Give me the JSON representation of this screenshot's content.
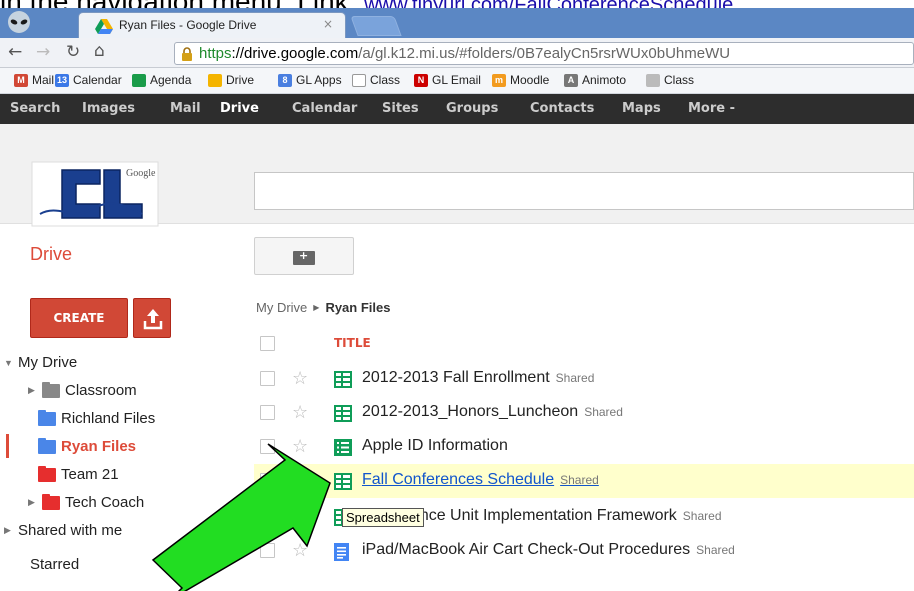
{
  "caption": {
    "text": "in the navigation menu.  Link: ",
    "link": "www.tinyurl.com/FallConferenceSchedule"
  },
  "browser": {
    "tab_title": "Ryan Files - Google Drive",
    "tab_close": "×",
    "url_scheme": "https",
    "url_host": "://drive.google.com",
    "url_path": "/a/gl.k12.mi.us/#folders/0B7ealyCn5rsrWUx0bUhmeWU"
  },
  "bookmarks": [
    {
      "label": "Mail",
      "icon": "gmail-icon",
      "color": "#d14836",
      "glyph": "M"
    },
    {
      "label": "Calendar",
      "icon": "calendar-icon",
      "color": "#3b78e7",
      "glyph": "13"
    },
    {
      "label": "Agenda",
      "icon": "agenda-icon",
      "color": "#1a9c4a",
      "glyph": ""
    },
    {
      "label": "Drive",
      "icon": "drive-icon",
      "color": "#f4b400",
      "glyph": ""
    },
    {
      "label": "GL Apps",
      "icon": "gl-apps-icon",
      "color": "#4a7fe0",
      "glyph": "8"
    },
    {
      "label": "Class",
      "icon": "page-icon",
      "color": "#ffffff",
      "glyph": ""
    },
    {
      "label": "GL Email",
      "icon": "gl-email-icon",
      "color": "#cc0000",
      "glyph": "N"
    },
    {
      "label": "Moodle",
      "icon": "moodle-icon",
      "color": "#f29b1f",
      "glyph": "m"
    },
    {
      "label": "Animoto",
      "icon": "animoto-icon",
      "color": "#777777",
      "glyph": "A"
    },
    {
      "label": "Class",
      "icon": "class-icon",
      "color": "#bbbbbb",
      "glyph": ""
    }
  ],
  "gbar": [
    "Search",
    "Images",
    "Mail",
    "Drive",
    "Calendar",
    "Sites",
    "Groups",
    "Contacts",
    "Maps",
    "More -"
  ],
  "org_logo_text": "Google",
  "app_title": "Drive",
  "create_label": "CREATE",
  "tree": [
    {
      "label": "My Drive",
      "caret": "▼",
      "folder": null
    },
    {
      "label": "Classroom",
      "caret": "▶",
      "folder": "#888888"
    },
    {
      "label": "Richland Files",
      "caret": "",
      "folder": "#4a86e8"
    },
    {
      "label": "Ryan Files",
      "caret": "",
      "folder": "#4a86e8",
      "selected": true
    },
    {
      "label": "Team 21",
      "caret": "",
      "folder": "#e62e2e"
    },
    {
      "label": "Tech Coach",
      "caret": "▶",
      "folder": "#e62e2e"
    },
    {
      "label": "Shared with me",
      "caret": "▶",
      "folder": null
    },
    {
      "label": "Starred",
      "caret": "",
      "folder": null
    }
  ],
  "breadcrumb": {
    "root": "My Drive",
    "sep": "▶",
    "current": "Ryan Files"
  },
  "list_header": "TITLE",
  "files": [
    {
      "name": "2012-2013 Fall Enrollment",
      "shared": "Shared",
      "type": "spreadsheet"
    },
    {
      "name": "2012-2013_Honors_Luncheon",
      "shared": "Shared",
      "type": "spreadsheet"
    },
    {
      "name": "Apple ID Information",
      "shared": "",
      "type": "form"
    },
    {
      "name": "Fall Conferences Schedule",
      "shared": "Shared",
      "type": "spreadsheet",
      "highlight": true
    },
    {
      "name": "8th Science Unit Implementation Framework",
      "shared": "Shared",
      "type": "spreadsheet"
    },
    {
      "name": "iPad/MacBook Air Cart Check-Out Procedures",
      "shared": "Shared",
      "type": "document"
    }
  ],
  "tooltip": "Spreadsheet",
  "colors": {
    "accent": "#dd4b39",
    "link": "#1155cc",
    "arrow": "#22dd22"
  }
}
